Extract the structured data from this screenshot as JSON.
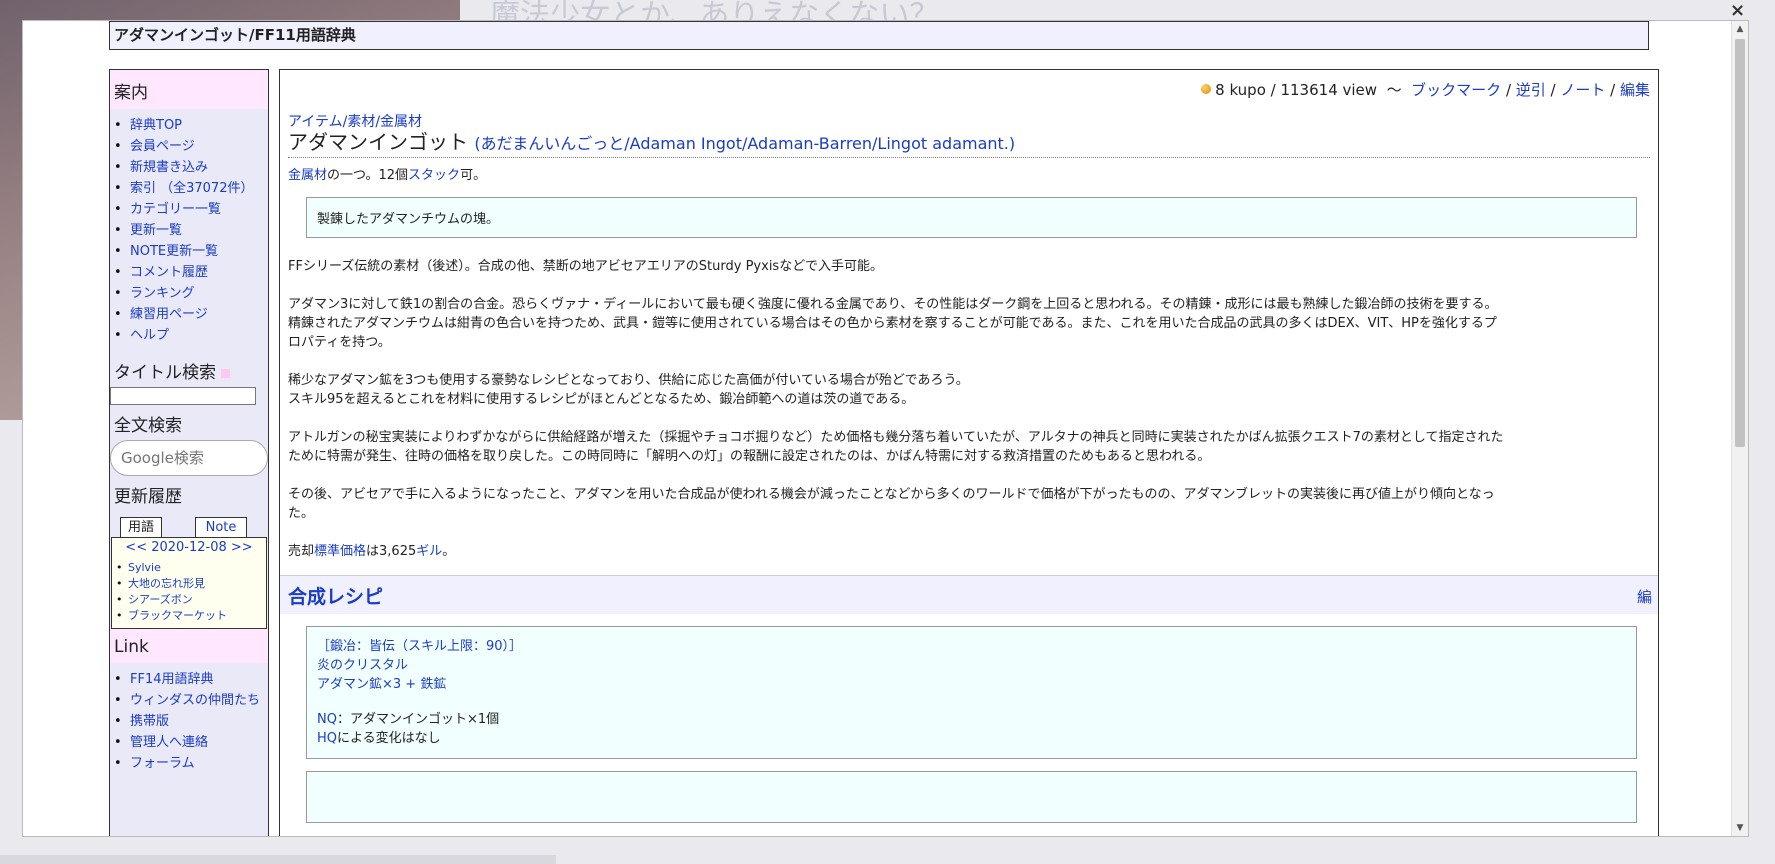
{
  "window": {
    "close_glyph": "×"
  },
  "backdrop": {
    "title": "魔法少女とか、ありえなくない？"
  },
  "header": {
    "title": "アダマンインゴット/FF11用語辞典"
  },
  "sidebar": {
    "guide_title": "案内",
    "guide_items": [
      "辞典TOP",
      "会員ページ",
      "新規書き込み",
      "索引 （全37072件）",
      "カテゴリー一覧",
      "更新一覧",
      "NOTE更新一覧",
      "コメント履歴",
      "ランキング",
      "練習用ページ",
      "ヘルプ"
    ],
    "title_search_label": "タイトル検索",
    "fulltext_search_label": "全文検索",
    "google_placeholder": "Google検索",
    "history_label": "更新履歴",
    "tab_terms": "用語",
    "tab_note": "Note",
    "cal_nav": "<< 2020-12-08 >>",
    "history_items": [
      "Sylvie",
      "大地の忘れ形見",
      "シアーズボン",
      "ブラックマーケット"
    ],
    "link_title": "Link",
    "link_items": [
      "FF14用語辞典",
      "ウィンダスの仲間たち",
      "携帯版",
      "管理人へ連絡",
      "フォーラム"
    ]
  },
  "main": {
    "meta_kupo": "8 kupo / 113614 view",
    "meta_sep": "〜",
    "meta_links": [
      "ブックマーク",
      "逆引",
      "ノート",
      "編集"
    ],
    "breadcrumb": "アイテム/素材/金属材",
    "page_title": "アダマンインゴット",
    "reading": "(あだまんいんごっと/Adaman Ingot/Adaman-Barren/Lingot adamant.)",
    "intro_link1": "金属材",
    "intro_text1": "の一つ。12個",
    "intro_link2": "スタック",
    "intro_text2": "可。",
    "quote_text": "製錬したアダマンチウムの塊。",
    "p1": "FFシリーズ伝統の素材（後述）。合成の他、禁断の地アビセアエリアのSturdy Pyxisなどで入手可能。",
    "p2a": "アダマン3に対して鉄1の割合の合金。恐らくヴァナ・ディールにおいて最も硬く強度に優れる金属であり、その性能はダーク鋼を上回ると思われる。その精錬・成形には最も熟練した鍛冶師の技術を要する。",
    "p2b": "精錬されたアダマンチウムは紺青の色合いを持つため、武具・鎧等に使用されている場合はその色から素材を察することが可能である。また、これを用いた合成品の武具の多くはDEX、VIT、HPを強化するプ",
    "p2c": "ロパティを持つ。",
    "p3a": "稀少なアダマン鉱を3つも使用する豪勢なレシピとなっており、供給に応じた高価が付いている場合が殆どであろう。",
    "p3b": "スキル95を超えるとこれを材料に使用するレシピがほとんどとなるため、鍛冶師範への道は茨の道である。",
    "p4a": "アトルガンの秘宝実装によりわずかながらに供給経路が増えた（採掘やチョコボ掘りなど）ため価格も幾分落ち着いていたが、アルタナの神兵と同時に実装されたかばん拡張クエスト7の素材として指定された",
    "p4b": "ために特需が発生、往時の価格を取り戻した。この時同時に「解明への灯」の報酬に設定されたのは、かばん特需に対する救済措置のためもあると思われる。",
    "p5a": "その後、アビセアで手に入るようになったこと、アダマンを用いた合成品が使われる機会が減ったことなどから多くのワールドで価格が下がったものの、アダマンブレットの実装後に再び値上がり傾向となっ",
    "p5b": "た。",
    "p6a": "売却",
    "p6link": "標準価格",
    "p6b": "は3,625",
    "p6link2": "ギル",
    "p6c": "。",
    "section_title": "合成レシピ",
    "section_edit": "編",
    "recipe": {
      "skill": "［鍛冶：皆伝（スキル上限：90）］",
      "crystal": "炎のクリスタル",
      "materials": "アダマン鉱×3 + 鉄鉱",
      "nq_label": "NQ",
      "nq_text": "：アダマンインゴット×1個",
      "hq_label": "HQ",
      "hq_text": "による変化はなし"
    }
  }
}
